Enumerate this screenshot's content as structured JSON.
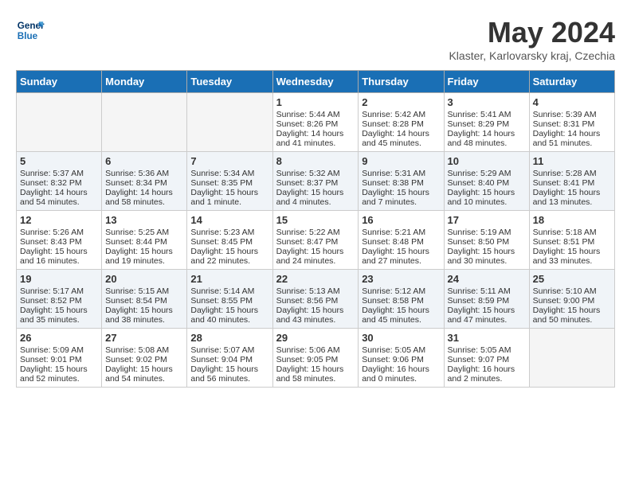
{
  "header": {
    "logo_line1": "General",
    "logo_line2": "Blue",
    "month_title": "May 2024",
    "location": "Klaster, Karlovarsky kraj, Czechia"
  },
  "weekdays": [
    "Sunday",
    "Monday",
    "Tuesday",
    "Wednesday",
    "Thursday",
    "Friday",
    "Saturday"
  ],
  "weeks": [
    [
      {
        "day": "",
        "text": ""
      },
      {
        "day": "",
        "text": ""
      },
      {
        "day": "",
        "text": ""
      },
      {
        "day": "1",
        "text": "Sunrise: 5:44 AM\nSunset: 8:26 PM\nDaylight: 14 hours\nand 41 minutes."
      },
      {
        "day": "2",
        "text": "Sunrise: 5:42 AM\nSunset: 8:28 PM\nDaylight: 14 hours\nand 45 minutes."
      },
      {
        "day": "3",
        "text": "Sunrise: 5:41 AM\nSunset: 8:29 PM\nDaylight: 14 hours\nand 48 minutes."
      },
      {
        "day": "4",
        "text": "Sunrise: 5:39 AM\nSunset: 8:31 PM\nDaylight: 14 hours\nand 51 minutes."
      }
    ],
    [
      {
        "day": "5",
        "text": "Sunrise: 5:37 AM\nSunset: 8:32 PM\nDaylight: 14 hours\nand 54 minutes."
      },
      {
        "day": "6",
        "text": "Sunrise: 5:36 AM\nSunset: 8:34 PM\nDaylight: 14 hours\nand 58 minutes."
      },
      {
        "day": "7",
        "text": "Sunrise: 5:34 AM\nSunset: 8:35 PM\nDaylight: 15 hours\nand 1 minute."
      },
      {
        "day": "8",
        "text": "Sunrise: 5:32 AM\nSunset: 8:37 PM\nDaylight: 15 hours\nand 4 minutes."
      },
      {
        "day": "9",
        "text": "Sunrise: 5:31 AM\nSunset: 8:38 PM\nDaylight: 15 hours\nand 7 minutes."
      },
      {
        "day": "10",
        "text": "Sunrise: 5:29 AM\nSunset: 8:40 PM\nDaylight: 15 hours\nand 10 minutes."
      },
      {
        "day": "11",
        "text": "Sunrise: 5:28 AM\nSunset: 8:41 PM\nDaylight: 15 hours\nand 13 minutes."
      }
    ],
    [
      {
        "day": "12",
        "text": "Sunrise: 5:26 AM\nSunset: 8:43 PM\nDaylight: 15 hours\nand 16 minutes."
      },
      {
        "day": "13",
        "text": "Sunrise: 5:25 AM\nSunset: 8:44 PM\nDaylight: 15 hours\nand 19 minutes."
      },
      {
        "day": "14",
        "text": "Sunrise: 5:23 AM\nSunset: 8:45 PM\nDaylight: 15 hours\nand 22 minutes."
      },
      {
        "day": "15",
        "text": "Sunrise: 5:22 AM\nSunset: 8:47 PM\nDaylight: 15 hours\nand 24 minutes."
      },
      {
        "day": "16",
        "text": "Sunrise: 5:21 AM\nSunset: 8:48 PM\nDaylight: 15 hours\nand 27 minutes."
      },
      {
        "day": "17",
        "text": "Sunrise: 5:19 AM\nSunset: 8:50 PM\nDaylight: 15 hours\nand 30 minutes."
      },
      {
        "day": "18",
        "text": "Sunrise: 5:18 AM\nSunset: 8:51 PM\nDaylight: 15 hours\nand 33 minutes."
      }
    ],
    [
      {
        "day": "19",
        "text": "Sunrise: 5:17 AM\nSunset: 8:52 PM\nDaylight: 15 hours\nand 35 minutes."
      },
      {
        "day": "20",
        "text": "Sunrise: 5:15 AM\nSunset: 8:54 PM\nDaylight: 15 hours\nand 38 minutes."
      },
      {
        "day": "21",
        "text": "Sunrise: 5:14 AM\nSunset: 8:55 PM\nDaylight: 15 hours\nand 40 minutes."
      },
      {
        "day": "22",
        "text": "Sunrise: 5:13 AM\nSunset: 8:56 PM\nDaylight: 15 hours\nand 43 minutes."
      },
      {
        "day": "23",
        "text": "Sunrise: 5:12 AM\nSunset: 8:58 PM\nDaylight: 15 hours\nand 45 minutes."
      },
      {
        "day": "24",
        "text": "Sunrise: 5:11 AM\nSunset: 8:59 PM\nDaylight: 15 hours\nand 47 minutes."
      },
      {
        "day": "25",
        "text": "Sunrise: 5:10 AM\nSunset: 9:00 PM\nDaylight: 15 hours\nand 50 minutes."
      }
    ],
    [
      {
        "day": "26",
        "text": "Sunrise: 5:09 AM\nSunset: 9:01 PM\nDaylight: 15 hours\nand 52 minutes."
      },
      {
        "day": "27",
        "text": "Sunrise: 5:08 AM\nSunset: 9:02 PM\nDaylight: 15 hours\nand 54 minutes."
      },
      {
        "day": "28",
        "text": "Sunrise: 5:07 AM\nSunset: 9:04 PM\nDaylight: 15 hours\nand 56 minutes."
      },
      {
        "day": "29",
        "text": "Sunrise: 5:06 AM\nSunset: 9:05 PM\nDaylight: 15 hours\nand 58 minutes."
      },
      {
        "day": "30",
        "text": "Sunrise: 5:05 AM\nSunset: 9:06 PM\nDaylight: 16 hours\nand 0 minutes."
      },
      {
        "day": "31",
        "text": "Sunrise: 5:05 AM\nSunset: 9:07 PM\nDaylight: 16 hours\nand 2 minutes."
      },
      {
        "day": "",
        "text": ""
      }
    ]
  ]
}
